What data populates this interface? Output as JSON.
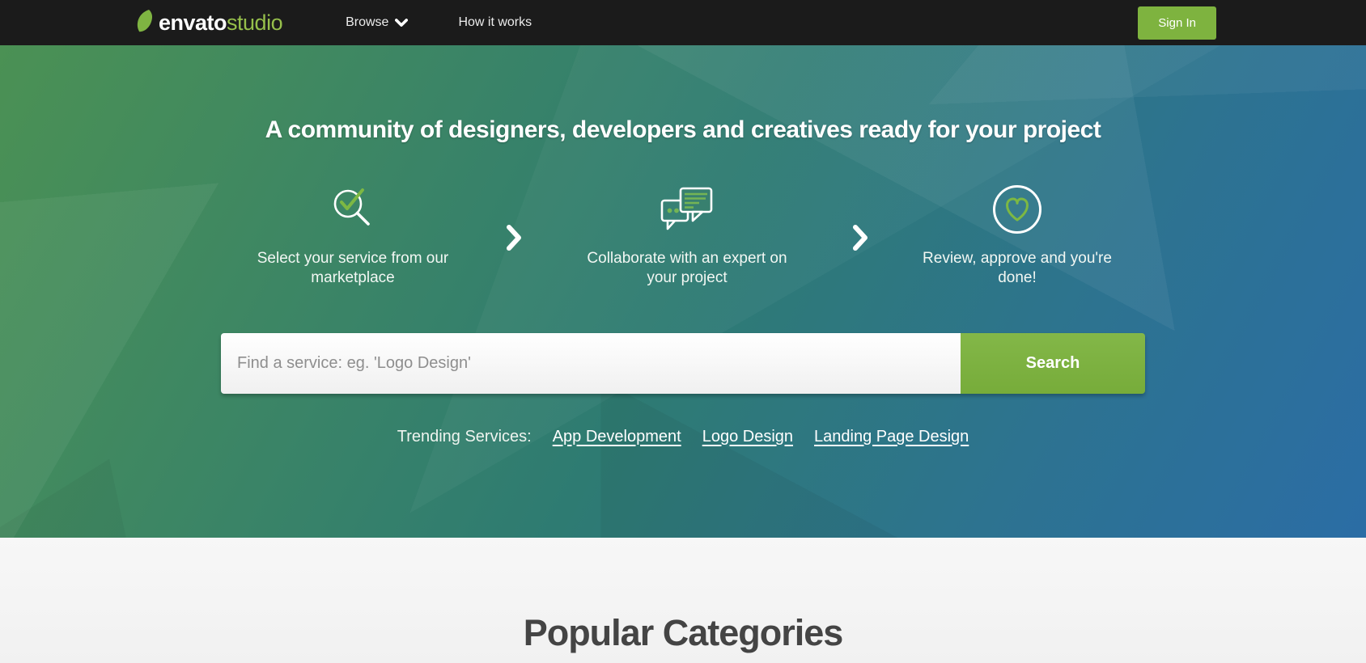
{
  "navbar": {
    "logo": {
      "word_envato": "envato",
      "word_studio": "studio",
      "icon": "envato-leaf-icon"
    },
    "links": [
      {
        "label": "Browse",
        "has_dropdown": true,
        "icon": "chevron-down-icon"
      },
      {
        "label": "How it works",
        "has_dropdown": false
      }
    ],
    "sign_in_label": "Sign In"
  },
  "hero": {
    "headline": "A community of designers, developers and creatives ready for your project",
    "steps": [
      {
        "icon": "magnifier-check-icon",
        "label": "Select your service from our marketplace"
      },
      {
        "icon": "chat-bubbles-icon",
        "label": "Collaborate with an expert on your project"
      },
      {
        "icon": "heart-circle-icon",
        "label": "Review, approve and you're done!"
      }
    ],
    "step_separator_icon": "chevron-right-icon",
    "search": {
      "placeholder": "Find a service: eg. 'Logo Design'",
      "value": "",
      "button_label": "Search"
    },
    "trending": {
      "label": "Trending Services:",
      "links": [
        "App Development",
        "Logo Design",
        "Landing Page Design"
      ]
    }
  },
  "popular": {
    "title": "Popular Categories"
  },
  "colors": {
    "accent_green": "#7eb33f",
    "logo_studio_green": "#96bf4b",
    "navbar_bg": "#1b1b1b",
    "hero_gradient_start": "#4b9154",
    "hero_gradient_mid": "#2e7b72",
    "hero_gradient_end": "#2b6da5",
    "section_bg": "#f4f4f4",
    "heading_gray": "#444444"
  }
}
